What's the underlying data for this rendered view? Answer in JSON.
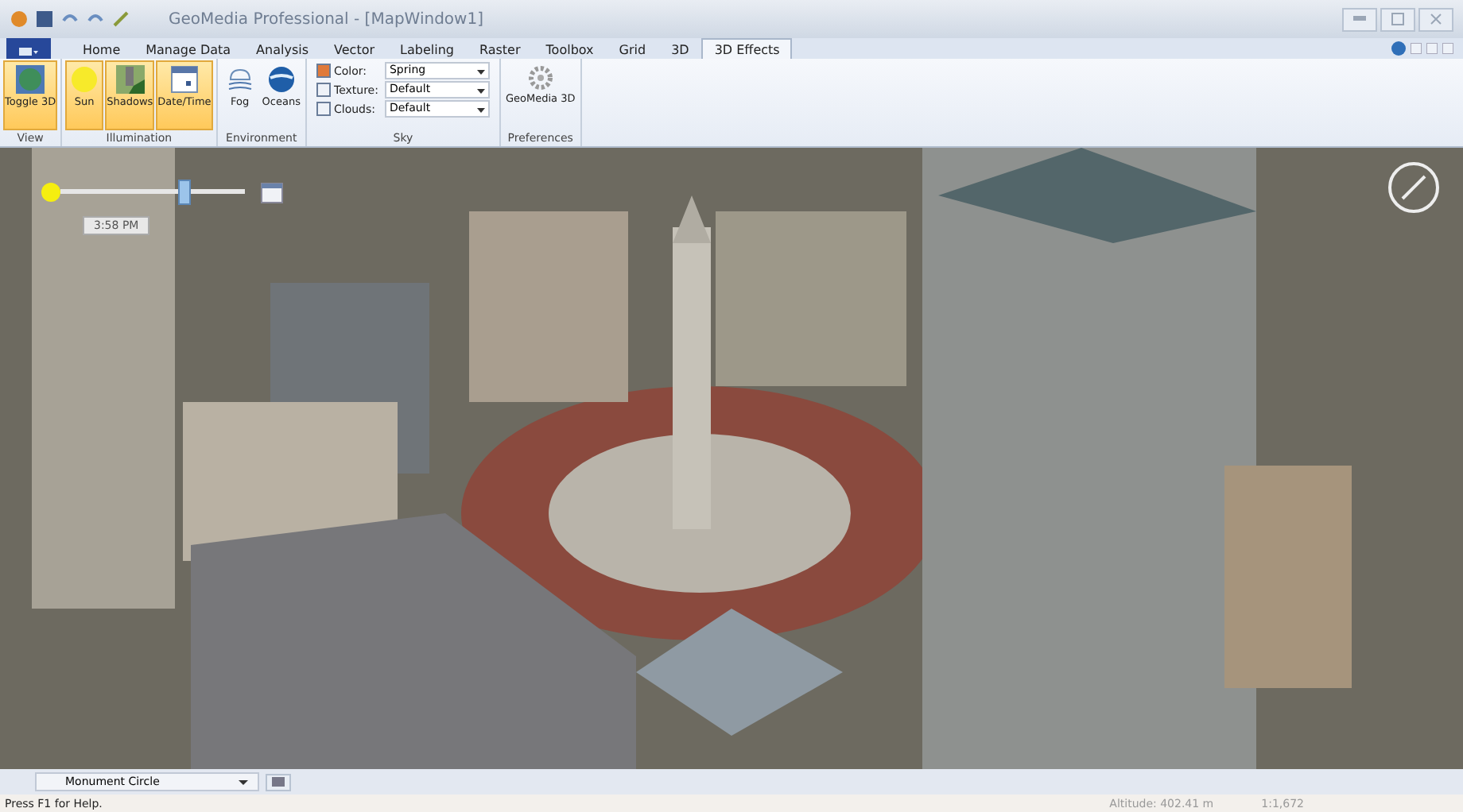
{
  "window": {
    "title": "GeoMedia Professional - [MapWindow1]"
  },
  "tabs": [
    {
      "label": "Home",
      "selected": false
    },
    {
      "label": "Manage Data",
      "selected": false
    },
    {
      "label": "Analysis",
      "selected": false
    },
    {
      "label": "Vector",
      "selected": false
    },
    {
      "label": "Labeling",
      "selected": false
    },
    {
      "label": "Raster",
      "selected": false
    },
    {
      "label": "Toolbox",
      "selected": false
    },
    {
      "label": "Grid",
      "selected": false
    },
    {
      "label": "3D",
      "selected": false
    },
    {
      "label": "3D Effects",
      "selected": true
    }
  ],
  "ribbon_groups": [
    {
      "title": "View",
      "buttons": [
        {
          "label": "Toggle 3D",
          "on": true
        }
      ]
    },
    {
      "title": "Illumination",
      "buttons": [
        {
          "label": "Sun",
          "on": true
        },
        {
          "label": "Shadows",
          "on": true
        },
        {
          "label": "Date/Time",
          "on": true
        }
      ]
    },
    {
      "title": "Environment",
      "buttons": [
        {
          "label": "Fog",
          "on": false
        },
        {
          "label": "Oceans",
          "on": false
        }
      ]
    },
    {
      "title": "Sky",
      "fields": [
        {
          "label": "Color:",
          "value": "Spring"
        },
        {
          "label": "Texture:",
          "value": "Default"
        },
        {
          "label": "Clouds:",
          "value": "Default"
        }
      ]
    },
    {
      "title": "Preferences",
      "buttons": [
        {
          "label": "GeoMedia 3D",
          "on": false
        }
      ]
    }
  ],
  "map": {
    "kind": "picture",
    "time_slider": {
      "level": 0.68,
      "time": "3:58 PM"
    }
  },
  "location_combo": {
    "value": "Monument Circle"
  },
  "status_bar": {
    "help": "Press F1 for Help.",
    "altitude": "Altitude: 402.41 m",
    "scale": "1:1,672"
  }
}
